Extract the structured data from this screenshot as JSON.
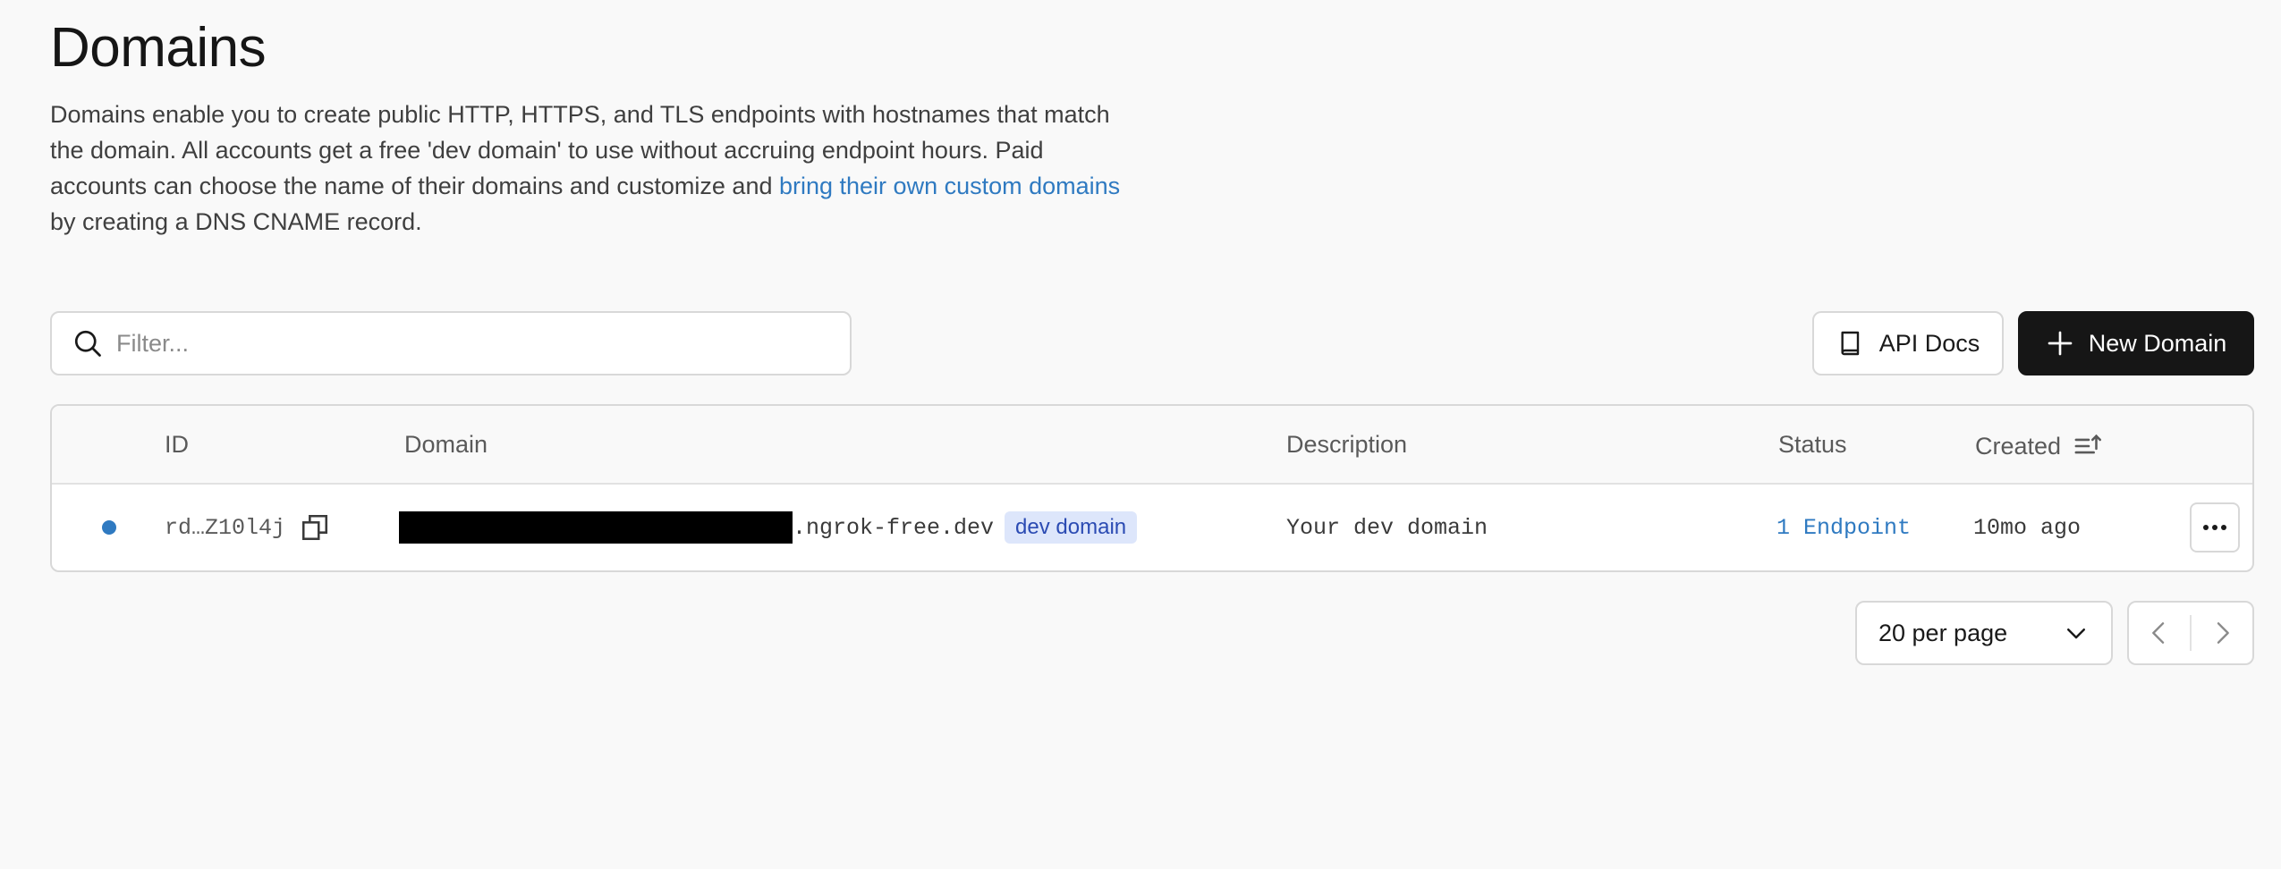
{
  "page": {
    "title": "Domains",
    "description_part1": "Domains enable you to create public HTTP, HTTPS, and TLS endpoints with hostnames that match the domain. All accounts get a free 'dev domain' to use without accruing endpoint hours. Paid accounts can choose the name of their domains and customize and ",
    "description_link": "bring their own custom domains",
    "description_part2": " by creating a DNS CNAME record."
  },
  "toolbar": {
    "filter_placeholder": "Filter...",
    "api_docs_label": "API Docs",
    "new_domain_label": "New Domain"
  },
  "table": {
    "columns": {
      "id": "ID",
      "domain": "Domain",
      "description": "Description",
      "status": "Status",
      "created": "Created"
    },
    "rows": [
      {
        "id": "rd…Z10l4j",
        "domain_suffix": ".ngrok-free.dev",
        "badge": "dev domain",
        "description": "Your dev domain",
        "status": "1 Endpoint",
        "created": "10mo ago"
      }
    ]
  },
  "pagination": {
    "per_page_label": "20 per page"
  },
  "colors": {
    "accent": "#2f7ac1",
    "primary_button": "#161616",
    "badge_bg": "#dde6fb",
    "badge_text": "#2b4bb3"
  }
}
